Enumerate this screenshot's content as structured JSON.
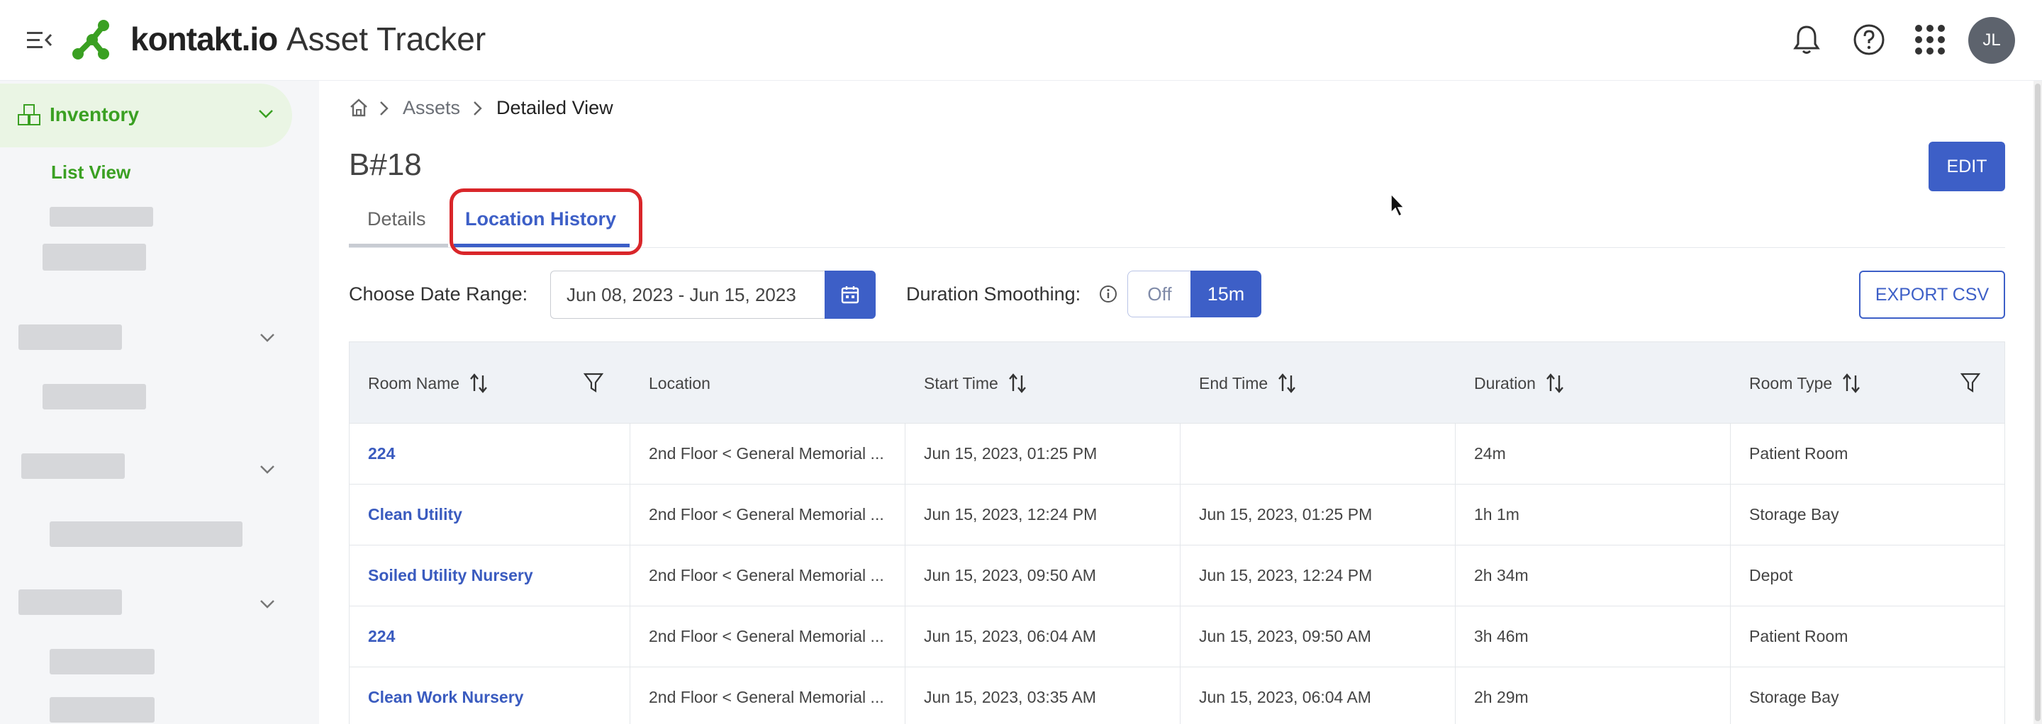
{
  "header": {
    "logo_text": "kontakt.io",
    "app_title": "Asset Tracker",
    "avatar_initials": "JL",
    "icons": [
      "menu-collapse-icon",
      "bell-icon",
      "help-icon",
      "apps-grid-icon"
    ]
  },
  "sidebar": {
    "active_section": "Inventory",
    "active_subitem": "List View"
  },
  "breadcrumb": {
    "items": [
      "Assets"
    ],
    "current": "Detailed View"
  },
  "asset": {
    "title": "B#18",
    "edit_label": "EDIT"
  },
  "tabs": [
    {
      "label": "Details",
      "active": false
    },
    {
      "label": "Location History",
      "active": true
    }
  ],
  "filters": {
    "date_range_label": "Choose Date Range:",
    "date_range_value": "Jun 08, 2023 - Jun 15, 2023",
    "smoothing_label": "Duration Smoothing:",
    "smoothing_off": "Off",
    "smoothing_on": "15m",
    "export_label": "EXPORT CSV"
  },
  "table": {
    "columns": [
      "Room Name",
      "Location",
      "Start Time",
      "End Time",
      "Duration",
      "Room Type"
    ],
    "rows": [
      {
        "room": "224",
        "location": "2nd Floor < General Memorial ...",
        "start": "Jun 15, 2023, 01:25 PM",
        "end": "",
        "duration": "24m",
        "type": "Patient Room"
      },
      {
        "room": "Clean Utility",
        "location": "2nd Floor < General Memorial ...",
        "start": "Jun 15, 2023, 12:24 PM",
        "end": "Jun 15, 2023, 01:25 PM",
        "duration": "1h 1m",
        "type": "Storage Bay"
      },
      {
        "room": "Soiled Utility Nursery",
        "location": "2nd Floor < General Memorial ...",
        "start": "Jun 15, 2023, 09:50 AM",
        "end": "Jun 15, 2023, 12:24 PM",
        "duration": "2h 34m",
        "type": "Depot"
      },
      {
        "room": "224",
        "location": "2nd Floor < General Memorial ...",
        "start": "Jun 15, 2023, 06:04 AM",
        "end": "Jun 15, 2023, 09:50 AM",
        "duration": "3h 46m",
        "type": "Patient Room"
      },
      {
        "room": "Clean Work Nursery",
        "location": "2nd Floor < General Memorial ...",
        "start": "Jun 15, 2023, 03:35 AM",
        "end": "Jun 15, 2023, 06:04 AM",
        "duration": "2h 29m",
        "type": "Storage Bay"
      }
    ]
  },
  "colors": {
    "primary": "#3d5fc7",
    "brand_green": "#3aa022",
    "highlight_red": "#d9262a"
  }
}
